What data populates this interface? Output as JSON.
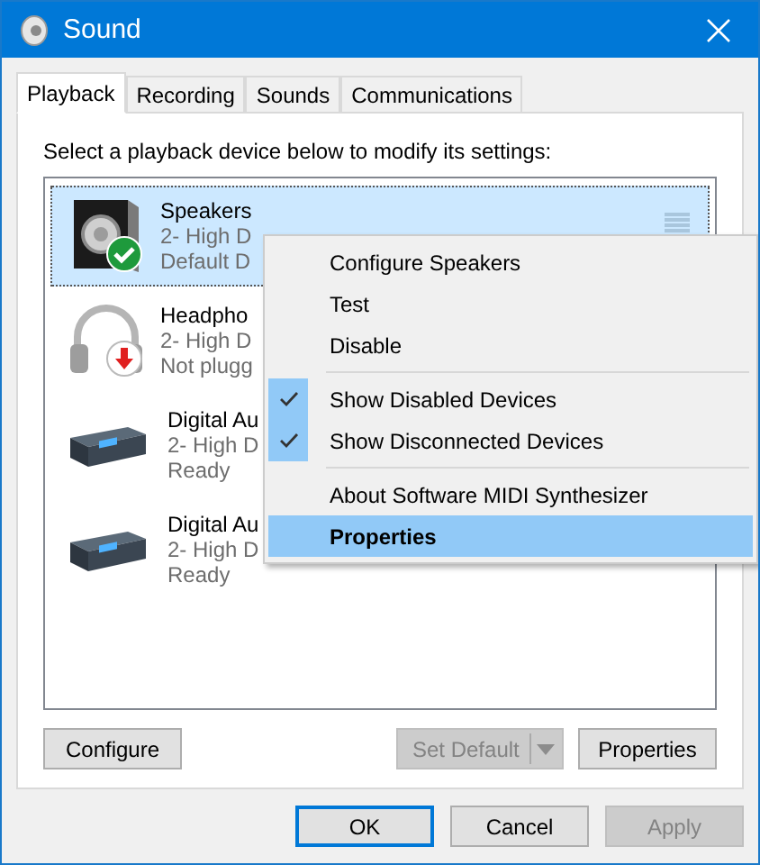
{
  "window": {
    "title": "Sound"
  },
  "tabs": [
    {
      "label": "Playback",
      "selected": true
    },
    {
      "label": "Recording",
      "selected": false
    },
    {
      "label": "Sounds",
      "selected": false
    },
    {
      "label": "Communications",
      "selected": false
    }
  ],
  "instruction": "Select a playback device below to modify its settings:",
  "devices": [
    {
      "kind": "speaker",
      "badge": {
        "kind": "check"
      },
      "name": "Speakers",
      "line_2": "2- High D",
      "line_3": "Default D",
      "selected": true
    },
    {
      "kind": "headphones",
      "badge": {
        "kind": "down-arrow"
      },
      "name": "Headpho",
      "line_2": "2- High D",
      "line_3": "Not plugg",
      "selected": false
    },
    {
      "kind": "digital",
      "name": "Digital Au",
      "line_2": "2- High D",
      "line_3": "Ready",
      "selected": false
    },
    {
      "kind": "digital",
      "name": "Digital Au",
      "line_2": "2- High D",
      "line_3": "Ready",
      "selected": false
    }
  ],
  "panel_buttons": [
    {
      "kind": "button",
      "label": "Configure",
      "disabled": false
    },
    {
      "kind": "split",
      "label": "Set Default",
      "disabled": true
    },
    {
      "kind": "button",
      "label": "Properties",
      "disabled": false
    }
  ],
  "dialog_buttons": [
    {
      "label": "OK",
      "default": true,
      "disabled": false
    },
    {
      "label": "Cancel",
      "default": false,
      "disabled": false
    },
    {
      "label": "Apply",
      "default": false,
      "disabled": true
    }
  ],
  "context_menu": [
    {
      "kind": "item",
      "label": "Configure Speakers",
      "checked": false,
      "selected": false,
      "default": false
    },
    {
      "kind": "item",
      "label": "Test",
      "checked": false,
      "selected": false,
      "default": false
    },
    {
      "kind": "item",
      "label": "Disable",
      "checked": false,
      "selected": false,
      "default": false
    },
    {
      "kind": "separator"
    },
    {
      "kind": "item",
      "label": "Show Disabled Devices",
      "checked": true,
      "selected": false,
      "default": false
    },
    {
      "kind": "item",
      "label": "Show Disconnected Devices",
      "checked": true,
      "selected": false,
      "default": false
    },
    {
      "kind": "separator"
    },
    {
      "kind": "item",
      "label": "About Software MIDI Synthesizer",
      "checked": false,
      "selected": false,
      "default": false
    },
    {
      "kind": "item",
      "label": "Properties",
      "checked": false,
      "selected": true,
      "default": true
    }
  ]
}
